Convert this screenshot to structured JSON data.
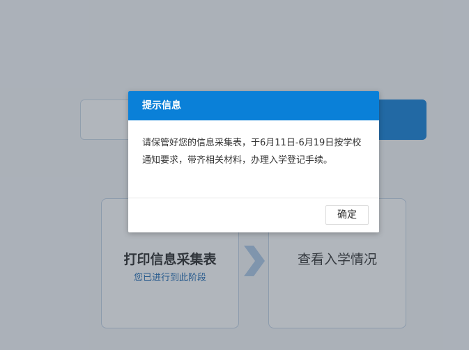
{
  "steps": [
    {
      "title": "打印信息采集表",
      "subtitle": "您已进行到此阶段"
    },
    {
      "title": "查看入学情况"
    }
  ],
  "dialog": {
    "title": "提示信息",
    "message": "请保管好您的信息采集表，于6月11日-6月19日按学校通知要求，带齐相关材料，办理入学登记手续。",
    "ok_label": "确定"
  },
  "colors": {
    "primary": "#0a80d8",
    "step_subtitle": "#1765b0",
    "arrow": "#a9c6e6"
  }
}
